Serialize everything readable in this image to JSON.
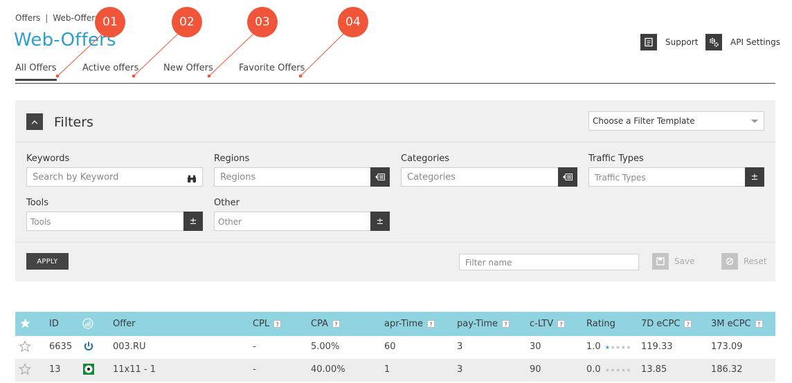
{
  "breadcrumb": {
    "items": [
      "Offers",
      "Web-Offers"
    ],
    "separator": "|"
  },
  "page_title": "Web-Offers",
  "header_links": {
    "support": "Support",
    "api_settings": "API Settings"
  },
  "tabs": [
    {
      "label": "All Offers",
      "active": true
    },
    {
      "label": "Active offers",
      "active": false
    },
    {
      "label": "New Offers",
      "active": false
    },
    {
      "label": "Favorite Offers",
      "active": false
    }
  ],
  "markers": [
    "01",
    "02",
    "03",
    "04"
  ],
  "marker_color": "#f0553a",
  "accent_color": "#2a9fd0",
  "filters": {
    "title": "Filters",
    "template_select": "Choose a Filter Template",
    "keywords": {
      "label": "Keywords",
      "placeholder": "Search by Keyword"
    },
    "regions": {
      "label": "Regions",
      "placeholder": "Regions"
    },
    "categories": {
      "label": "Categories",
      "placeholder": "Categories"
    },
    "traffic_types": {
      "label": "Traffic Types",
      "placeholder": "Traffic Types"
    },
    "tools": {
      "label": "Tools",
      "placeholder": "Tools"
    },
    "other": {
      "label": "Other",
      "placeholder": "Other"
    },
    "plus_minus": "±",
    "apply": "APPLY",
    "filter_name_placeholder": "Filter name",
    "save": "Save",
    "reset": "Reset"
  },
  "table": {
    "header_color": "#8fd4e0",
    "columns": {
      "id": "ID",
      "offer": "Offer",
      "cpl": "CPL",
      "cpa": "CPA",
      "apr_time": "apr-Time",
      "pay_time": "pay-Time",
      "c_ltv": "c-LTV",
      "rating": "Rating",
      "ecpc_7d": "7D eCPC",
      "ecpc_3m": "3M eCPC"
    },
    "help_mark": "?",
    "rows": [
      {
        "id": "6635",
        "offer": "003.RU",
        "cpl": "-",
        "cpa": "5.00%",
        "apr_time": "60",
        "pay_time": "3",
        "c_ltv": "30",
        "rating": "1.0",
        "rating_stars": 1,
        "ecpc_7d": "119.33",
        "ecpc_3m": "173.09",
        "icon": "power-icon"
      },
      {
        "id": "13",
        "offer": "11x11 - 1",
        "cpl": "-",
        "cpa": "40.00%",
        "apr_time": "1",
        "pay_time": "3",
        "c_ltv": "90",
        "rating": "0.0",
        "rating_stars": 0,
        "ecpc_7d": "13.85",
        "ecpc_3m": "186.32",
        "icon": "soccer-ball-icon"
      }
    ]
  }
}
